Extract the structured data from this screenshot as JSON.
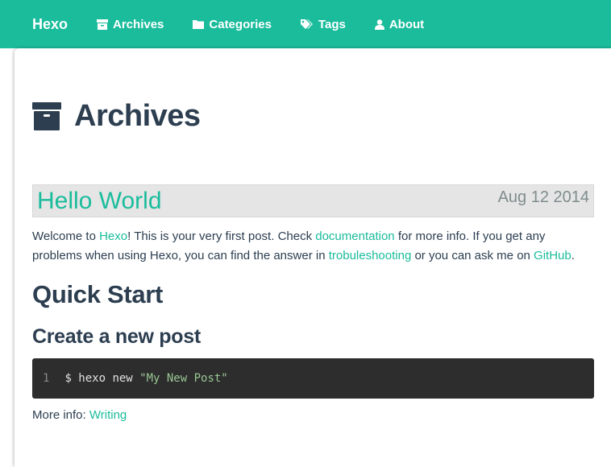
{
  "navbar": {
    "brand": "Hexo",
    "items": [
      {
        "label": "Archives",
        "icon": "archive-icon"
      },
      {
        "label": "Categories",
        "icon": "folder-icon"
      },
      {
        "label": "Tags",
        "icon": "tags-icon"
      },
      {
        "label": "About",
        "icon": "user-icon"
      }
    ],
    "background_color": "#1abc9c"
  },
  "page": {
    "title": "Archives",
    "icon": "archive-icon"
  },
  "post": {
    "title": "Hello World",
    "date": "Aug 12 2014",
    "intro": {
      "t1": "Welcome to ",
      "link_hexo": "Hexo",
      "t2": "! This is your very first post. Check ",
      "link_docs": "documentation",
      "t3": " for more info. If you get any problems when using Hexo, you can find the answer in ",
      "link_trouble": "trobuleshooting",
      "t4": " or you can ask me on ",
      "link_github": "GitHub",
      "t5": "."
    },
    "section_title": "Quick Start",
    "subsection_title": "Create a new post",
    "code": {
      "line_number": "1",
      "command": "$ hexo new ",
      "argument": "\"My New Post\""
    },
    "more_info_label": "More info: ",
    "more_info_link": "Writing"
  },
  "colors": {
    "accent": "#1abc9c",
    "text": "#2c3e50",
    "date": "#7f8c8d",
    "code_bg": "#2d2d2d",
    "code_string": "#99c794"
  }
}
